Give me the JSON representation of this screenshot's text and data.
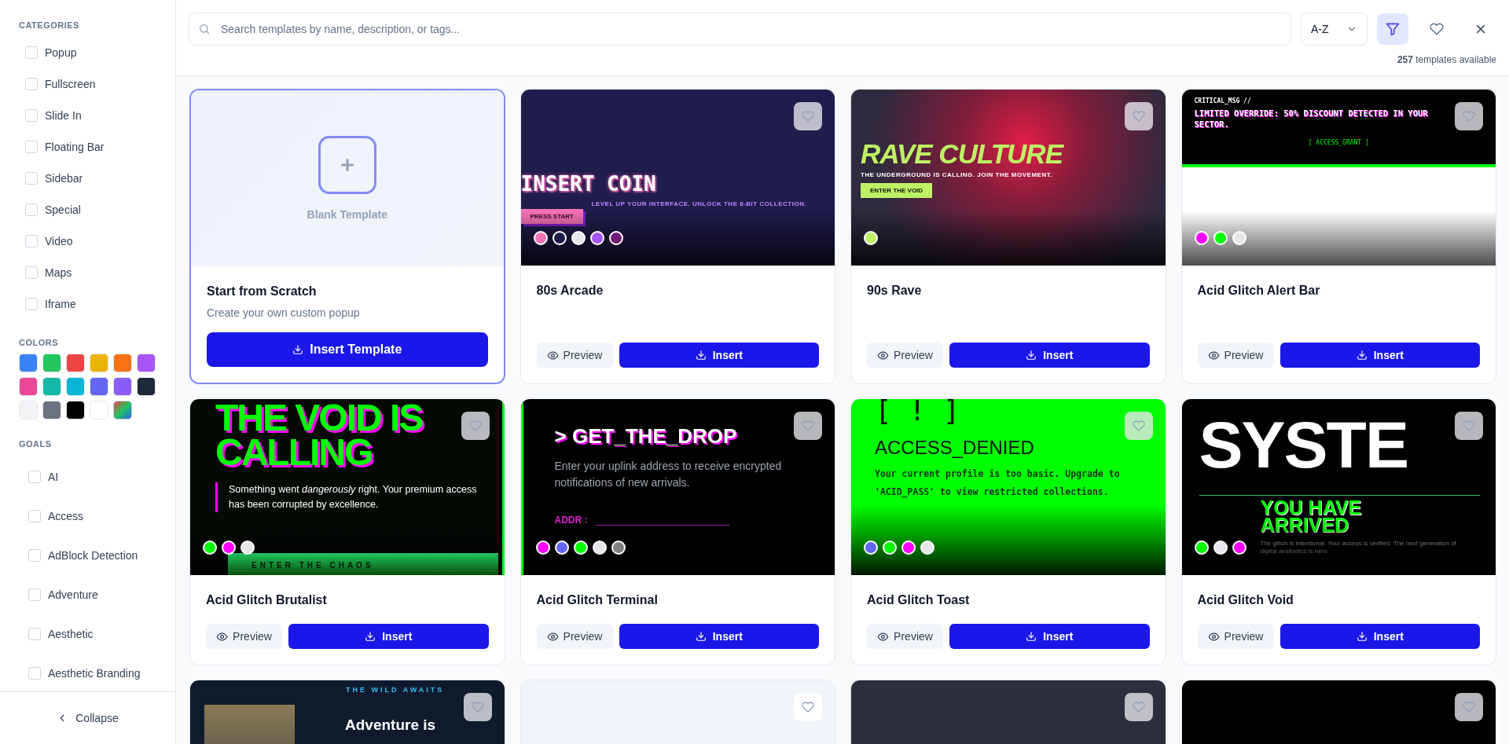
{
  "sidebar": {
    "sections": [
      {
        "kind": "checklist",
        "title": "CATEGORIES",
        "items": [
          {
            "label": "Popup",
            "checked": false
          },
          {
            "label": "Fullscreen",
            "checked": false
          },
          {
            "label": "Slide In",
            "checked": false
          },
          {
            "label": "Floating Bar",
            "checked": false
          },
          {
            "label": "Sidebar",
            "checked": false
          },
          {
            "label": "Special",
            "checked": false
          },
          {
            "label": "Video",
            "checked": false
          },
          {
            "label": "Maps",
            "checked": false
          },
          {
            "label": "Iframe",
            "checked": false
          }
        ]
      },
      {
        "kind": "swatches",
        "title": "COLORS",
        "swatches": [
          {
            "kind": "solid",
            "color": "#3b82f6"
          },
          {
            "kind": "solid",
            "color": "#22c55e"
          },
          {
            "kind": "solid",
            "color": "#ef4444"
          },
          {
            "kind": "solid",
            "color": "#eab308"
          },
          {
            "kind": "solid",
            "color": "#f97316"
          },
          {
            "kind": "solid",
            "color": "#a855f7"
          },
          {
            "kind": "solid",
            "color": "#ec4899"
          },
          {
            "kind": "solid",
            "color": "#14b8a6"
          },
          {
            "kind": "solid",
            "color": "#06b6d4"
          },
          {
            "kind": "solid",
            "color": "#6366f1"
          },
          {
            "kind": "solid",
            "color": "#8b5cf6"
          },
          {
            "kind": "solid",
            "color": "#1e293b"
          },
          {
            "kind": "solid",
            "color": "#f3f4f6"
          },
          {
            "kind": "solid",
            "color": "#6b7280"
          },
          {
            "kind": "solid",
            "color": "#000000"
          },
          {
            "kind": "solid",
            "color": "#ffffff"
          },
          {
            "kind": "multi"
          }
        ]
      },
      {
        "kind": "goals",
        "title": "GOALS",
        "items": [
          {
            "label": "AI",
            "checked": false
          },
          {
            "label": "Access",
            "checked": false
          },
          {
            "label": "AdBlock Detection",
            "checked": false
          },
          {
            "label": "Adventure",
            "checked": false
          },
          {
            "label": "Aesthetic",
            "checked": false
          },
          {
            "label": "Aesthetic Branding",
            "checked": false
          }
        ]
      }
    ],
    "collapse": "Collapse"
  },
  "toolbar": {
    "search": {
      "placeholder": "Search templates by name, description, or tags..."
    },
    "sort": {
      "value": "A-Z"
    },
    "filter": {
      "selected": true
    },
    "count": "**257** templates available"
  },
  "templates": [
    {
      "kind": "blank",
      "preview_label": "Blank Template",
      "title": "Start from Scratch",
      "description": "Create your own custom popup",
      "button": "Insert Template"
    },
    {
      "kind": "template",
      "title": "80s Arcade",
      "preview_button": "Preview",
      "insert_button": "Insert",
      "palette": [
        {
          "color": "#f472b6"
        },
        {
          "color": "#1e1b4b"
        },
        {
          "color": "#e5e7eb"
        },
        {
          "color": "#a855f7"
        },
        {
          "color": "#701a75"
        }
      ],
      "preview": {
        "kind": "arcade",
        "headline": "INSERT COIN",
        "subline": "LEVEL UP YOUR INTERFACE. UNLOCK THE 8-BIT COLLECTION.",
        "button": "PRESS START"
      }
    },
    {
      "kind": "template",
      "title": "90s Rave",
      "preview_button": "Preview",
      "insert_button": "Insert",
      "palette": [
        {
          "color": "#bef264"
        }
      ],
      "preview": {
        "kind": "rave",
        "headline": "RAVE CULTURE",
        "subline": "THE UNDERGROUND IS CALLING. JOIN THE MOVEMENT.",
        "button": "ENTER THE VOID"
      }
    },
    {
      "kind": "template",
      "title": "Acid Glitch Alert Bar",
      "preview_button": "Preview",
      "insert_button": "Insert",
      "palette": [
        {
          "color": "#ff00ff"
        },
        {
          "color": "#00ff00"
        },
        {
          "color": "#e5e7eb"
        }
      ],
      "preview": {
        "kind": "alert",
        "label": "CRITICAL_MSG //",
        "headline": "LIMITED OVERRIDE: 50% DISCOUNT DETECTED IN YOUR SECTOR.",
        "button": "[ ACCESS_GRANT ]"
      }
    },
    {
      "kind": "template",
      "title": "Acid Glitch Brutalist",
      "preview_button": "Preview",
      "insert_button": "Insert",
      "palette": [
        {
          "color": "#00ff00"
        },
        {
          "color": "#ff00ff"
        },
        {
          "color": "#e5e7eb"
        }
      ],
      "preview": {
        "kind": "brutalist",
        "headline": "THE VOID IS CALLING",
        "body": "Something went *dangerously* right. Your premium access has been corrupted by excellence.",
        "button": "ENTER THE CHAOS"
      }
    },
    {
      "kind": "template",
      "title": "Acid Glitch Terminal",
      "preview_button": "Preview",
      "insert_button": "Insert",
      "palette": [
        {
          "color": "#ff00ff"
        },
        {
          "color": "#6366f1"
        },
        {
          "color": "#00ff00"
        },
        {
          "color": "#e5e7eb"
        },
        {
          "color": "#808080"
        }
      ],
      "preview": {
        "kind": "terminal",
        "headline": "> GET_THE_DROP",
        "body": "Enter your uplink address to receive encrypted notifications of new arrivals.",
        "label": "ADDR :"
      }
    },
    {
      "kind": "template",
      "title": "Acid Glitch Toast",
      "preview_button": "Preview",
      "insert_button": "Insert",
      "palette": [
        {
          "color": "#6366f1"
        },
        {
          "color": "#00ff00"
        },
        {
          "color": "#ff00ff"
        },
        {
          "color": "#e5e7eb"
        }
      ],
      "preview": {
        "kind": "toast",
        "label": "[ ! ]",
        "headline": "ACCESS_DENIED",
        "body": "Your current profile is too basic. Upgrade to 'ACID_PASS' to view restricted collections."
      }
    },
    {
      "kind": "template",
      "title": "Acid Glitch Void",
      "preview_button": "Preview",
      "insert_button": "Insert",
      "palette": [
        {
          "color": "#00ff00"
        },
        {
          "color": "#e5e7eb"
        },
        {
          "color": "#ff00ff"
        }
      ],
      "preview": {
        "kind": "void",
        "headline": "SYSTE",
        "subline": "YOU HAVE ARRIVED",
        "body": "The glitch is intentional. Your access is verified. The next generation of digital aesthetics is here."
      }
    },
    {
      "kind": "template",
      "preview": {
        "kind": "adventure",
        "label": "THE WILD AWAITS",
        "headline": "Adventure is"
      }
    },
    {
      "kind": "template",
      "preview": {
        "kind": "light"
      }
    },
    {
      "kind": "template",
      "preview": {
        "kind": "slate"
      }
    },
    {
      "kind": "template",
      "preview": {
        "kind": "dark"
      }
    }
  ]
}
